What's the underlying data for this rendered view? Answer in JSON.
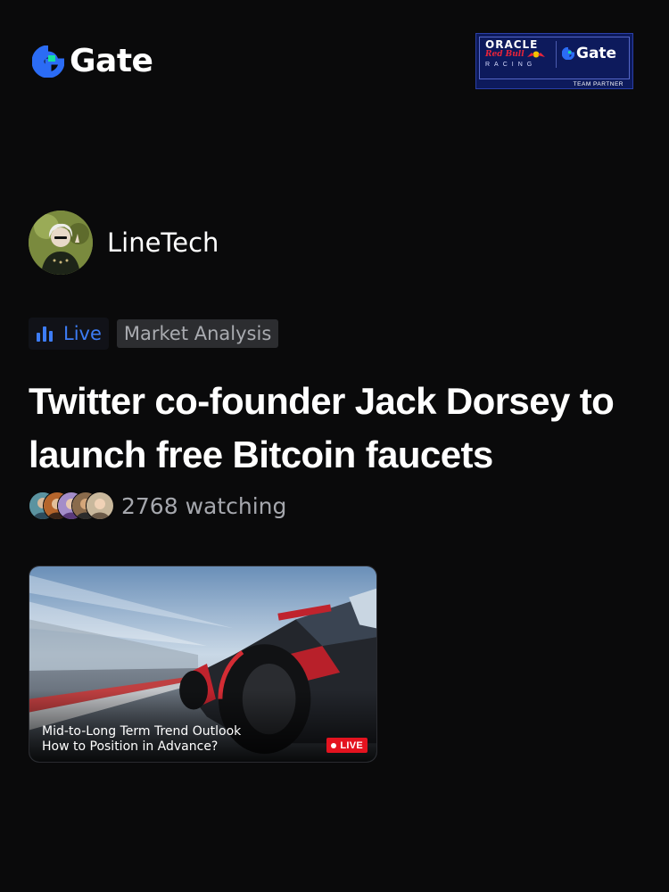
{
  "header": {
    "logo_text": "Gate",
    "partner": {
      "line1": "ORACLE",
      "line2": "Red Bull",
      "line3": "RACING",
      "brand": "Gate",
      "tagline": "TEAM PARTNER"
    }
  },
  "author": {
    "name": "LineTech",
    "avatar_icon": "avatar-image"
  },
  "tags": {
    "live_label": "Live",
    "category": "Market Analysis"
  },
  "post": {
    "title": "Twitter co-founder Jack Dorsey to launch free Bitcoin faucets"
  },
  "audience": {
    "watching": "2768 watching",
    "avatar_count": 5
  },
  "video": {
    "caption_line1": "Mid-to-Long Term Trend Outlook",
    "caption_line2": "How to Position in Advance?",
    "badge": "LIVE"
  },
  "colors": {
    "background": "#0a0a0b",
    "brand_blue": "#2b6cf5",
    "brand_green": "#17e0a0",
    "live_red": "#e4131f"
  }
}
